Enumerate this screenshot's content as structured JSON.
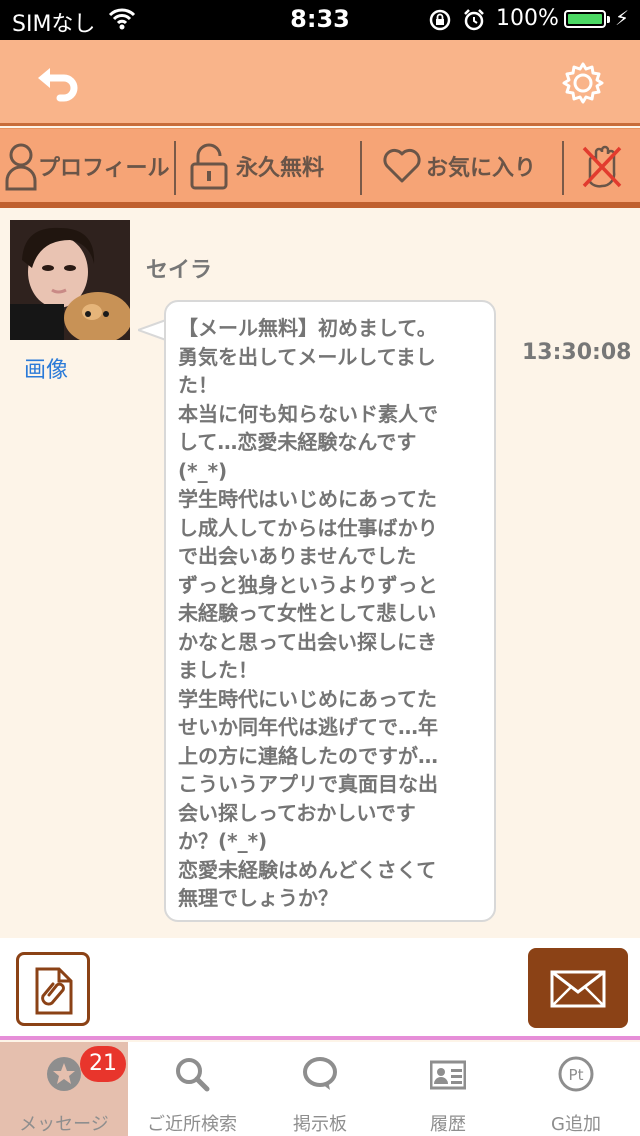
{
  "status_bar": {
    "carrier": "SIMなし",
    "time": "8:33",
    "battery": "100%"
  },
  "actions": {
    "profile": "プロフィール",
    "free_forever": "永久無料",
    "favorite": "お気に入り"
  },
  "message": {
    "sender": "セイラ",
    "image_link": "画像",
    "time": "13:30:08",
    "body": "【メール無料】初めまして。\n勇気を出してメールしてまし\nた！\n本当に何も知らないド素人で\nして…恋愛未経験なんです\n(*_*)\n学生時代はいじめにあってた\nし成人してからは仕事ばかり\nで出会いありませんでした\nずっと独身というよりずっと\n未経験って女性として悲しい\nかなと思って出会い探しにき\nました！\n学生時代にいじめにあってた\nせいか同年代は逃げてで…年\n上の方に連絡したのですが…\nこういうアプリで真面目な出\n会い探しっておかしいです\nか？(*_*)\n恋愛未経験はめんどくさくて\n無理でしょうか？"
  },
  "tabs": [
    {
      "label": "メッセージ",
      "badge": "21",
      "icon": "star-icon"
    },
    {
      "label": "ご近所検索",
      "icon": "search-icon"
    },
    {
      "label": "掲示板",
      "icon": "chat-bubble-icon"
    },
    {
      "label": "履歴",
      "icon": "id-card-icon"
    },
    {
      "label": "G追加",
      "icon": "points-icon",
      "icon_text": "Pt"
    }
  ],
  "colors": {
    "header": "#f9b48a",
    "action_bar": "#f6a476",
    "accent_brown": "#8b4216",
    "badge_red": "#e8352c",
    "link_blue": "#2a7ad8"
  }
}
